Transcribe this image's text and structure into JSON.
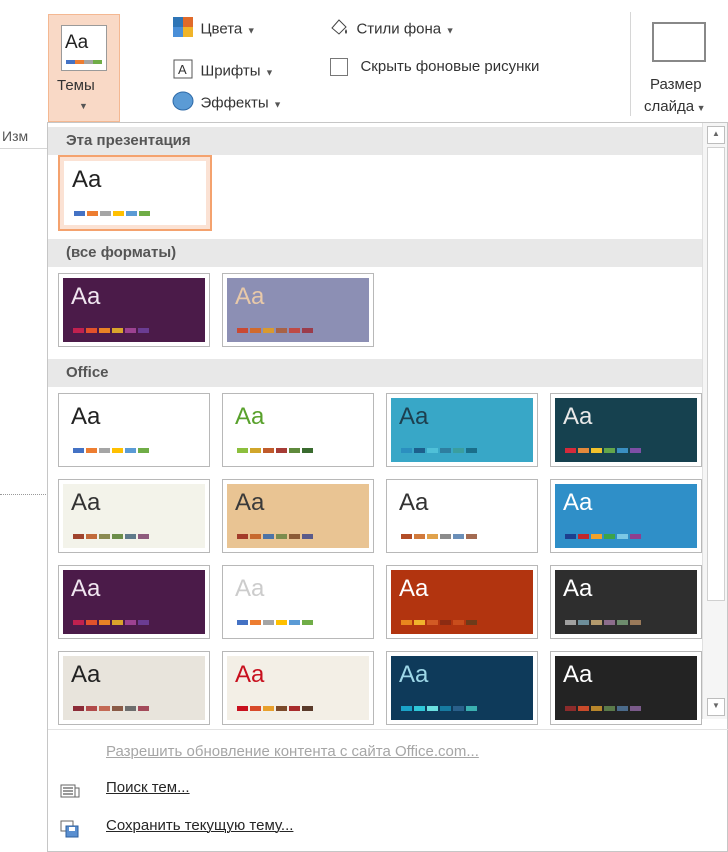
{
  "ribbon": {
    "themes_label": "Темы",
    "thumb_text": "Aa",
    "colors_label": "Цвета",
    "fonts_label": "Шрифты",
    "effects_label": "Эффекты",
    "bg_styles_label": "Стили фона",
    "hide_bg_label": "Скрыть фоновые рисунки",
    "hide_bg_checked": false,
    "slide_size_line1": "Размер",
    "slide_size_line2": "слайда",
    "behind_label": "Изм"
  },
  "gallery": {
    "sections": [
      {
        "title": "Эта презентация",
        "themes": [
          {
            "id": "current",
            "label": "Aa",
            "selected": true,
            "bg": "#ffffff",
            "fg": "#222222",
            "swatches": [
              "#4472c4",
              "#ed7d31",
              "#a5a5a5",
              "#ffc000",
              "#5b9bd5",
              "#70ad47"
            ]
          }
        ]
      },
      {
        "title": "(все форматы)",
        "themes": [
          {
            "id": "fmt-1",
            "label": "Aa",
            "bg": "#4b1b49",
            "fg": "#f0e6f0",
            "swatches": [
              "#c0214f",
              "#e2522b",
              "#e98225",
              "#d9a42c",
              "#9c4291",
              "#6a3c92"
            ]
          },
          {
            "id": "fmt-2",
            "label": "Aa",
            "bg": "#8c8fb4",
            "fg": "#e8c9a9",
            "swatches": [
              "#c94933",
              "#d06a2d",
              "#d99a2f",
              "#a86246",
              "#bf4a45",
              "#9b3c4b"
            ]
          }
        ]
      },
      {
        "title": "Office",
        "themes": [
          {
            "id": "office-1",
            "label": "Aa",
            "bg": "#ffffff",
            "fg": "#222222",
            "swatches": [
              "#4472c4",
              "#ed7d31",
              "#a5a5a5",
              "#ffc000",
              "#5b9bd5",
              "#70ad47"
            ]
          },
          {
            "id": "office-2",
            "label": "Aa",
            "bg": "#ffffff",
            "fg": "#59a12c",
            "swatches": [
              "#8cbf3d",
              "#d1a62b",
              "#c05b2b",
              "#a63c36",
              "#5f8a3c",
              "#3a6b2f"
            ]
          },
          {
            "id": "office-3",
            "label": "Aa",
            "bg": "#38a7c7",
            "fg": "#1d3f4f",
            "swatches": [
              "#2b8fbf",
              "#1c5f8c",
              "#4fc0d8",
              "#2e7ea0",
              "#3a9e9e",
              "#1a6e8a"
            ]
          },
          {
            "id": "office-4",
            "label": "Aa",
            "bg": "#16414f",
            "fg": "#e8e8e8",
            "swatches": [
              "#d52a3b",
              "#e3893b",
              "#f2c22c",
              "#63a64a",
              "#3a8fc1",
              "#7d4fa6"
            ]
          },
          {
            "id": "office-5",
            "label": "Aa",
            "bg": "#f3f3ea",
            "fg": "#333333",
            "swatches": [
              "#a0442e",
              "#c16a3b",
              "#8b8b52",
              "#6c8e4a",
              "#5f7a8b",
              "#8e5b7d"
            ]
          },
          {
            "id": "office-6",
            "label": "Aa",
            "bg": "#e9c493",
            "fg": "#3a3a3a",
            "swatches": [
              "#a33c2a",
              "#c7692e",
              "#4d73a6",
              "#7c8c4d",
              "#8c5b36",
              "#5a5a8a"
            ]
          },
          {
            "id": "office-7",
            "label": "Aa",
            "bg": "#ffffff",
            "fg": "#333333",
            "swatches": [
              "#b24d27",
              "#d17a3c",
              "#e0a24c",
              "#8c8c8c",
              "#6b8fb8",
              "#a36b52"
            ]
          },
          {
            "id": "office-8",
            "label": "Aa",
            "bg": "#2f8fc8",
            "fg": "#ffffff",
            "swatches": [
              "#1d3f8f",
              "#c1272d",
              "#f0a22b",
              "#3ca34a",
              "#7bc8e5",
              "#8f3f8f"
            ]
          },
          {
            "id": "office-9",
            "label": "Aa",
            "bg": "#4b1b49",
            "fg": "#f0e6f0",
            "swatches": [
              "#c0214f",
              "#e2522b",
              "#e98225",
              "#d9a42c",
              "#9c4291",
              "#6a3c92"
            ]
          },
          {
            "id": "office-10",
            "label": "Aa",
            "bg": "#ffffff",
            "fg": "#cccccc",
            "swatches": [
              "#4472c4",
              "#ed7d31",
              "#a5a5a5",
              "#ffc000",
              "#5b9bd5",
              "#70ad47"
            ]
          },
          {
            "id": "office-11",
            "label": "Aa",
            "bg": "#b2340f",
            "fg": "#ffffff",
            "swatches": [
              "#e8871e",
              "#f0b32c",
              "#d25a24",
              "#8c2b12",
              "#c94d1c",
              "#6e3b1a"
            ]
          },
          {
            "id": "office-12",
            "label": "Aa",
            "bg": "#2e2e2e",
            "fg": "#ffffff",
            "swatches": [
              "#a0a0a0",
              "#6d8e9a",
              "#b39a6d",
              "#8c6d8c",
              "#6d8c6d",
              "#9a7a5a"
            ]
          },
          {
            "id": "office-13",
            "label": "Aa",
            "bg": "#e8e4dc",
            "fg": "#222222",
            "swatches": [
              "#8c2b37",
              "#b14a4a",
              "#c46a55",
              "#8a5a46",
              "#6d6d6d",
              "#a34a5a"
            ]
          },
          {
            "id": "office-14",
            "label": "Aa",
            "bg": "#f3efe6",
            "fg": "#c8101e",
            "swatches": [
              "#c8101e",
              "#d84a2a",
              "#e8a02c",
              "#7c4a2a",
              "#a82c2c",
              "#5a3a2a"
            ]
          },
          {
            "id": "office-15",
            "label": "Aa",
            "bg": "#0e3a5a",
            "fg": "#9ed8e8",
            "swatches": [
              "#1aa3c8",
              "#2fc7d8",
              "#6be0e0",
              "#167aa0",
              "#2a5f8a",
              "#3ab0b0"
            ]
          },
          {
            "id": "office-16",
            "label": "Aa",
            "bg": "#232323",
            "fg": "#ffffff",
            "swatches": [
              "#8c2b2b",
              "#c94a2a",
              "#b8862b",
              "#5a7a4a",
              "#4a6a8a",
              "#7a5a8a"
            ]
          }
        ]
      }
    ]
  },
  "menu": {
    "enable_updates": "Разрешить обновление контента с сайта Office.com...",
    "browse_themes": "Поиск тем...",
    "save_theme": "Сохранить текущую тему..."
  }
}
